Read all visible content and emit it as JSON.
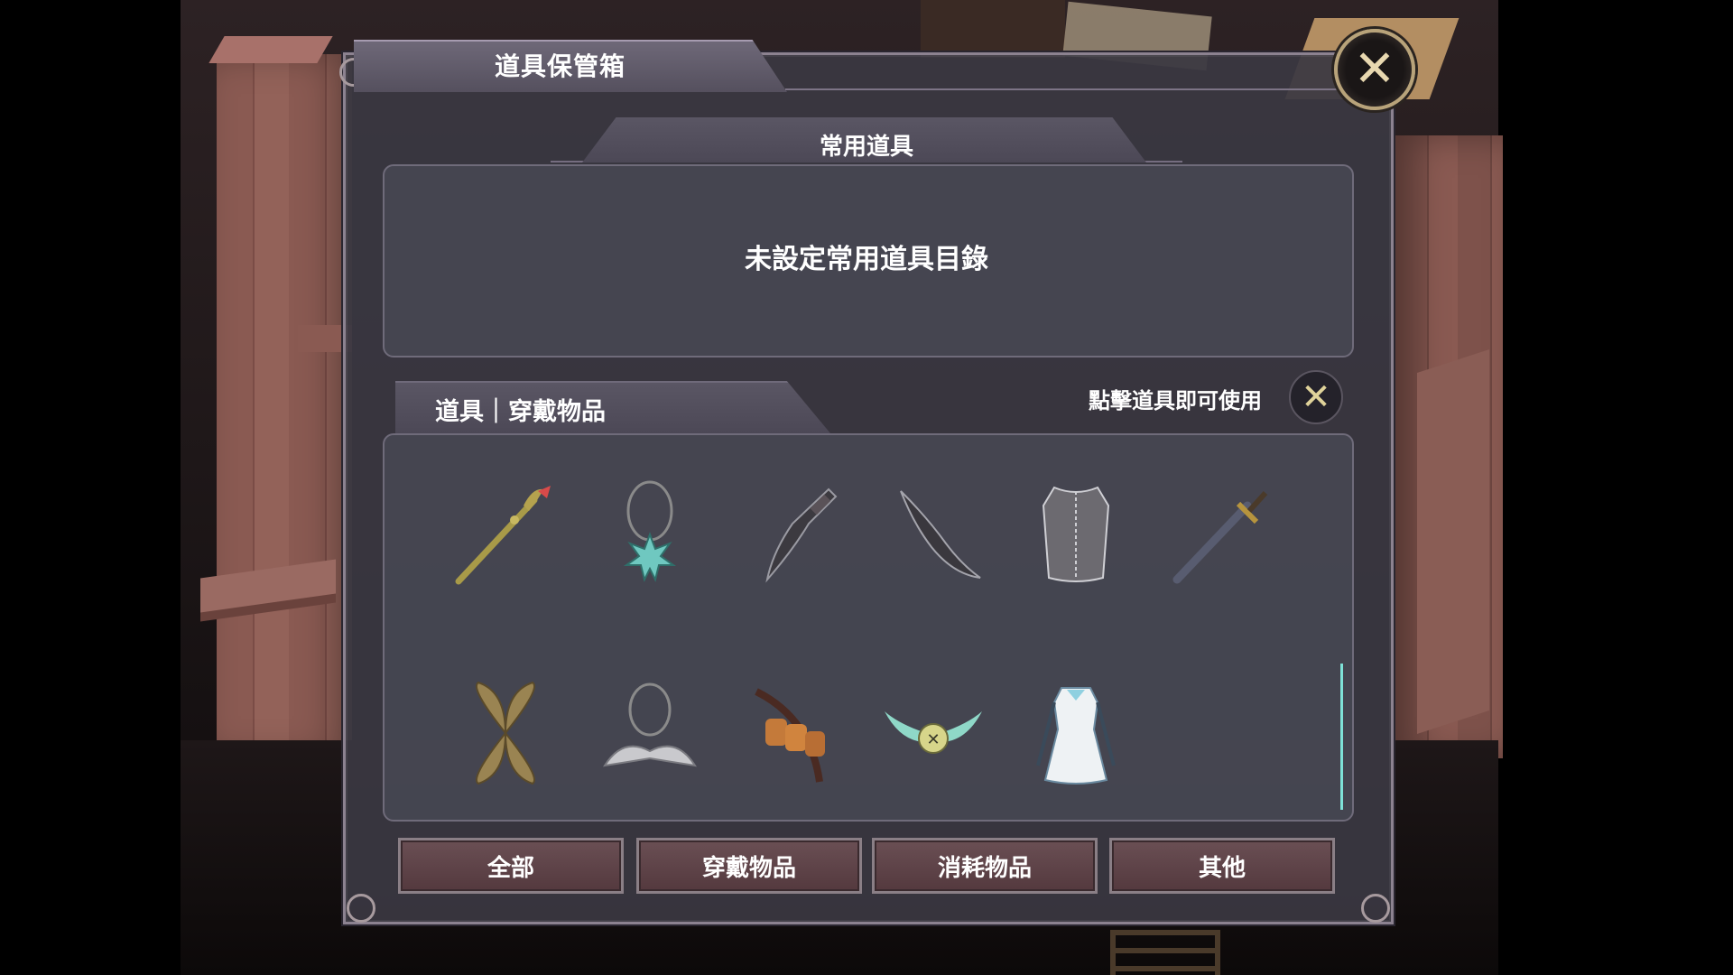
{
  "window": {
    "title": "道具保管箱"
  },
  "favorites": {
    "header": "常用道具",
    "empty_message": "未設定常用道具目錄"
  },
  "items_panel": {
    "tab_label": "道具｜穿戴物品",
    "hint": "點擊道具即可使用",
    "items": [
      {
        "icon": "staff-icon"
      },
      {
        "icon": "star-pendant-icon"
      },
      {
        "icon": "dark-blade-icon"
      },
      {
        "icon": "curved-dagger-icon"
      },
      {
        "icon": "chainmail-vest-icon"
      },
      {
        "icon": "longsword-icon"
      },
      {
        "icon": "wooden-wings-icon"
      },
      {
        "icon": "wing-necklace-icon"
      },
      {
        "icon": "pouch-belt-icon"
      },
      {
        "icon": "winged-charm-icon"
      },
      {
        "icon": "white-dress-icon"
      }
    ]
  },
  "filters": [
    {
      "label": "全部"
    },
    {
      "label": "穿戴物品"
    },
    {
      "label": "消耗物品"
    },
    {
      "label": "其他"
    }
  ],
  "colors": {
    "panel": "#3a3842",
    "accent_gold": "#b8a37a",
    "button": "#5e4449",
    "scroll": "#7ee2d8"
  }
}
